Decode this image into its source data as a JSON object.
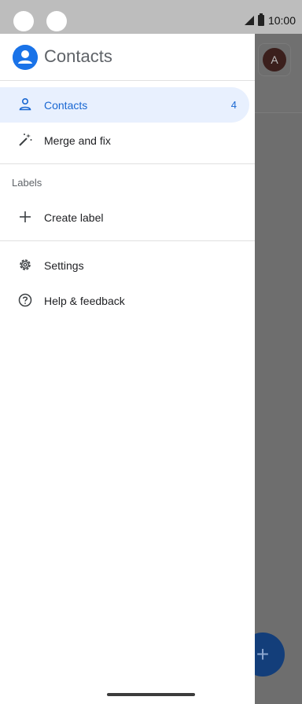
{
  "status": {
    "time": "10:00"
  },
  "drawer": {
    "title": "Contacts",
    "items": [
      {
        "label": "Contacts",
        "count": "4",
        "icon": "person-icon"
      },
      {
        "label": "Merge and fix",
        "icon": "magic-wand-icon"
      }
    ],
    "labels_header": "Labels",
    "create_label": "Create label",
    "settings": "Settings",
    "help": "Help & feedback"
  },
  "background": {
    "avatar_letter": "A",
    "fab_symbol": "+"
  },
  "colors": {
    "accent": "#1a73e8",
    "active_bg": "#e8f0fe",
    "active_text": "#1967d2"
  }
}
